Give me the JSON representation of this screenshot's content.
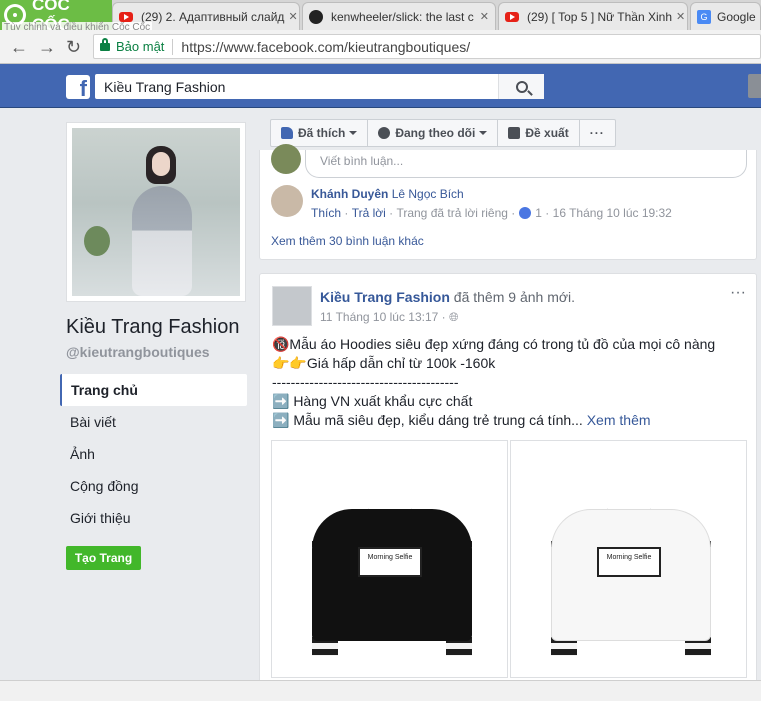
{
  "browser": {
    "brand": "CỐC CỐC",
    "tooltip": "Tùy chỉnh và điều khiển Cốc Cốc",
    "tabs": [
      {
        "title": "(29) 2. Адаптивный слайд",
        "icon": "youtube-icon"
      },
      {
        "title": "kenwheeler/slick: the last c",
        "icon": "github-icon"
      },
      {
        "title": "(29) [ Top 5 ] Nữ Thần Xinh",
        "icon": "youtube-icon"
      },
      {
        "title": "Google",
        "icon": "google-translate-icon"
      }
    ],
    "secure_label": "Bảo mật",
    "url": "https://www.facebook.com/kieutrangboutiques/"
  },
  "fb": {
    "search_value": "Kiều Trang Fashion",
    "brand_color": "#4267b2"
  },
  "page": {
    "name": "Kiều Trang Fashion",
    "username": "@kieutrangboutiques",
    "nav": [
      "Trang chủ",
      "Bài viết",
      "Ảnh",
      "Cộng đồng",
      "Giới thiệu"
    ],
    "create_button": "Tạo Trang"
  },
  "actions": {
    "like": "Đã thích",
    "follow": "Đang theo dõi",
    "suggest": "Đề xuất",
    "more": "···"
  },
  "comment": {
    "placeholder": "Viết bình luận...",
    "author": "Khánh Duyên",
    "tagged": "Lê Ngọc Bích",
    "like": "Thích",
    "reply": "Trả lời",
    "private_reply": "Trang đã trả lời riêng",
    "like_count": "1",
    "time": "16 Tháng 10 lúc 19:32",
    "more": "Xem thêm 30 bình luận khác"
  },
  "post": {
    "author": "Kiều Trang Fashion",
    "action": "đã thêm 9 ảnh mới.",
    "time": "11 Tháng 10 lúc 13:17 ·",
    "lines": [
      "🔞Mẫu áo Hoodies siêu đẹp xứng đáng có trong tủ đồ của mọi cô nàng",
      "👉👉Giá hấp dẫn chỉ từ 100k -160k",
      "----------------------------------------",
      "➡️ Hàng VN xuất khẩu cực chất",
      "➡️ Mẫu mã siêu đẹp, kiểu dáng trẻ trung cá tính..."
    ],
    "see_more": "Xem thêm",
    "images": [
      {
        "label_text": "Morning Selfie",
        "color": "#111111"
      },
      {
        "label_text": "Morning Selfie",
        "color": "#f7f7f7"
      }
    ]
  }
}
